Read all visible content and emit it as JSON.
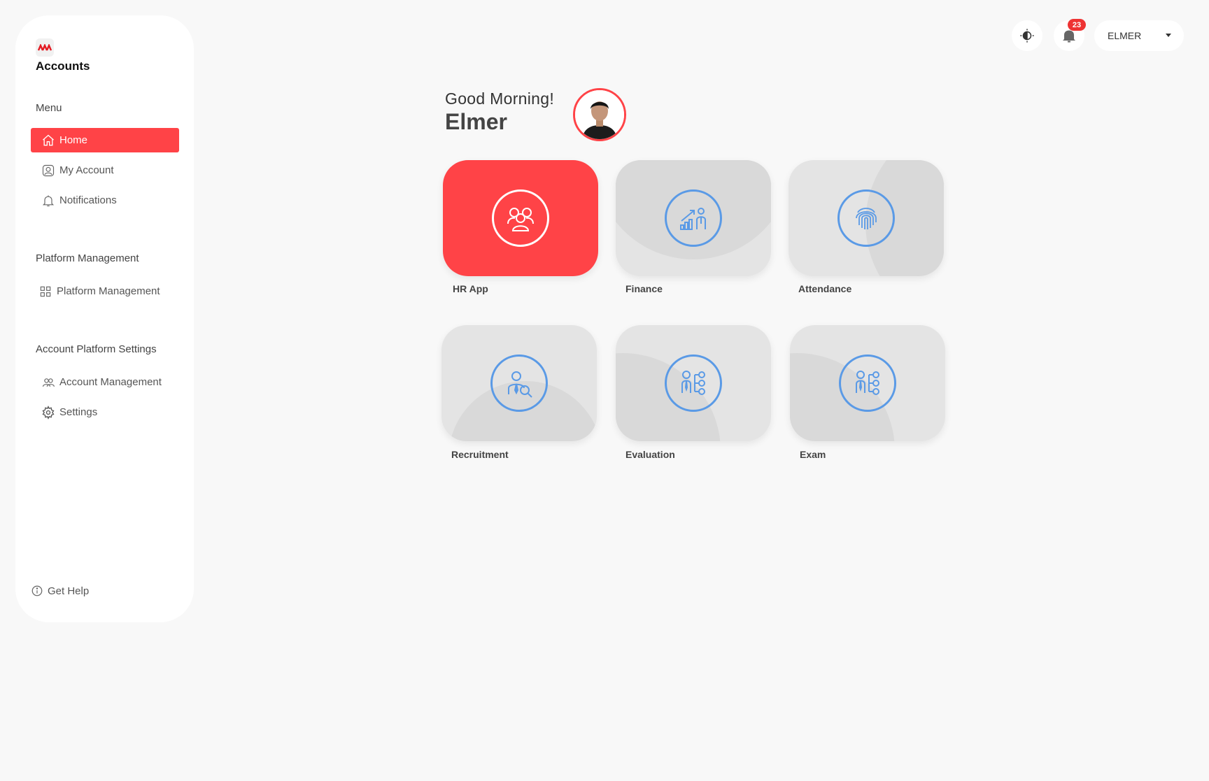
{
  "sidebar": {
    "brand": "Accounts",
    "menu_title": "Menu",
    "menu_items": [
      {
        "label": "Home",
        "icon": "home-icon",
        "active": true
      },
      {
        "label": "My Account",
        "icon": "user-icon"
      },
      {
        "label": "Notifications",
        "icon": "bell-icon"
      }
    ],
    "platform_title": "Platform Management",
    "platform_items": [
      {
        "label": "Platform Management",
        "icon": "grid-icon"
      }
    ],
    "settings_title": "Account Platform Settings",
    "settings_items": [
      {
        "label": "Account Management",
        "icon": "users-icon"
      },
      {
        "label": "Settings",
        "icon": "gear-icon"
      }
    ],
    "help_label": "Get Help"
  },
  "header": {
    "notification_count": "23",
    "user_menu_label": "ELMER"
  },
  "greeting": {
    "salutation": "Good Morning!",
    "name": "Elmer"
  },
  "apps": [
    {
      "label": "HR App",
      "icon": "team-icon",
      "active": true
    },
    {
      "label": "Finance",
      "icon": "finance-chart-icon"
    },
    {
      "label": "Attendance",
      "icon": "fingerprint-icon"
    },
    {
      "label": "Recruitment",
      "icon": "person-search-icon"
    },
    {
      "label": "Evaluation",
      "icon": "person-hierarchy-icon"
    },
    {
      "label": "Exam",
      "icon": "person-hierarchy-icon"
    }
  ],
  "colors": {
    "accent": "#ff4347",
    "icon_blue": "#5a9ae6",
    "card_bg": "#e4e4e4",
    "page_bg": "#f8f8f8"
  }
}
